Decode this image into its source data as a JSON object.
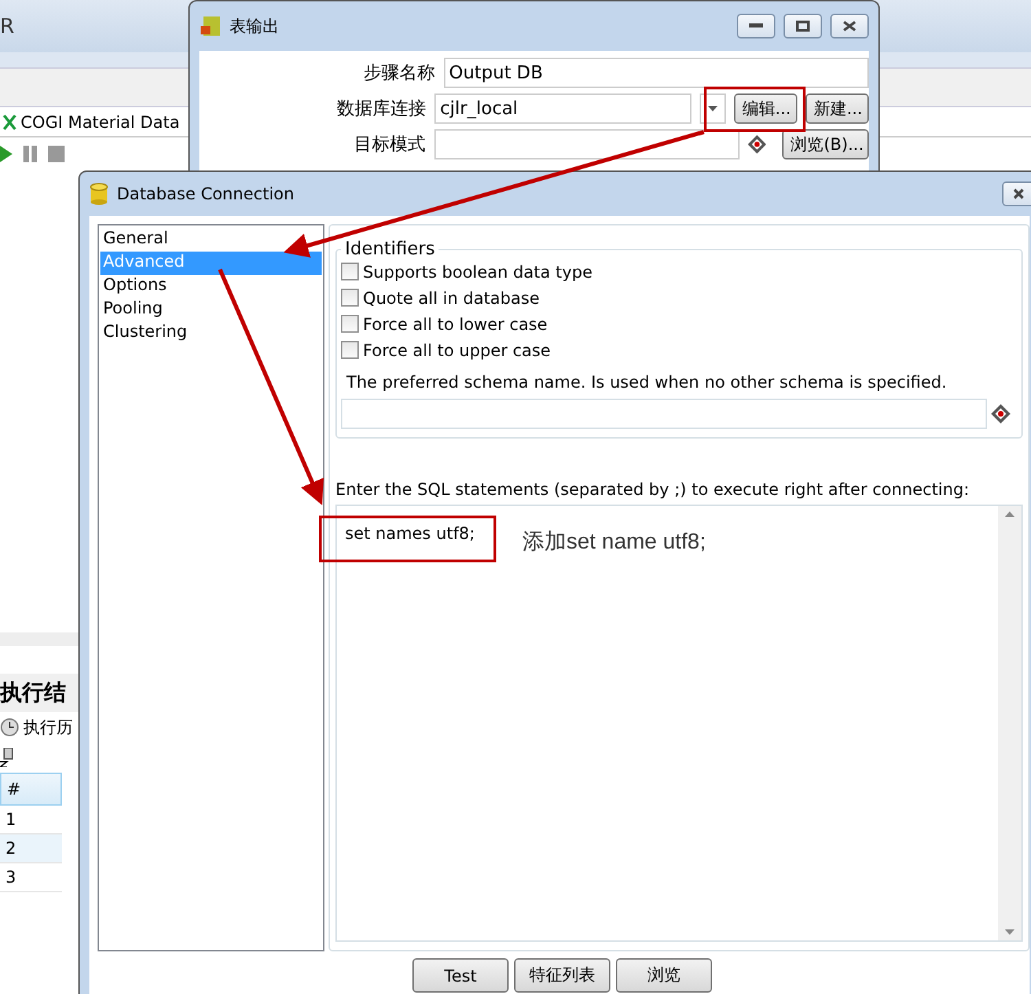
{
  "background_app": {
    "title_fragment": "R",
    "tab": "COGI Material Data",
    "results_title": "执行结",
    "history_tab": "执行历",
    "table": {
      "columns": [
        "#"
      ],
      "rows": [
        {
          "cells": [
            "1"
          ]
        },
        {
          "cells": [
            "2"
          ]
        },
        {
          "cells": [
            "3"
          ]
        }
      ]
    }
  },
  "step_dialog": {
    "title": "表输出",
    "fields": [
      {
        "kind": "text",
        "label": "步骤名称",
        "value": "Output DB"
      },
      {
        "kind": "combo",
        "label": "数据库连接",
        "value": "cjlr_local",
        "buttons": [
          "编辑...",
          "新建..."
        ]
      },
      {
        "kind": "variable",
        "label": "目标模式",
        "buttons": [
          "浏览(B)..."
        ]
      }
    ]
  },
  "connection_dialog": {
    "title": "Database Connection",
    "nav": [
      {
        "label": "General",
        "selected": false
      },
      {
        "label": "Advanced",
        "selected": true
      },
      {
        "label": "Options",
        "selected": false
      },
      {
        "label": "Pooling",
        "selected": false
      },
      {
        "label": "Clustering",
        "selected": false
      }
    ],
    "identifiers": {
      "title": "Identifiers",
      "options": [
        {
          "label": "Supports boolean data type",
          "checked": false
        },
        {
          "label": "Quote all in database",
          "checked": false
        },
        {
          "label": "Force all to lower case",
          "checked": false
        },
        {
          "label": "Force all to upper case",
          "checked": false
        }
      ],
      "schema_label": "The preferred schema name. Is used when no other schema is specified."
    },
    "sql_label": "Enter the SQL statements (separated by ;) to execute right after connecting:",
    "sql_value": "set names utf8;",
    "buttons": [
      "Test",
      "特征列表",
      "浏览"
    ]
  },
  "annotation": {
    "note": "添加set name utf8;"
  }
}
